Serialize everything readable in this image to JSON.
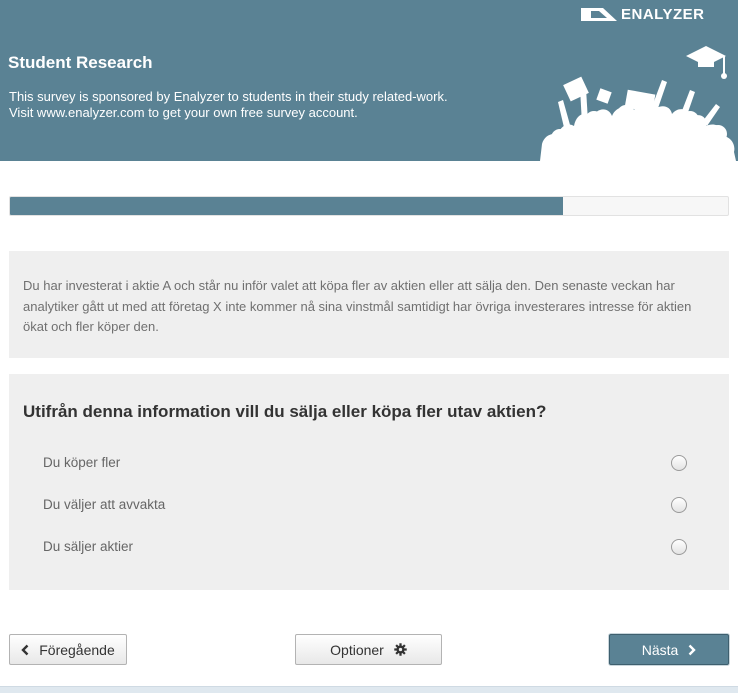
{
  "header": {
    "brand": "ENALYZER",
    "title": "Student Research",
    "description_lines": [
      "This survey is sponsored by Enalyzer to students in their study related-work.",
      "Visit www.enalyzer.com to get your own free survey account."
    ]
  },
  "progress": {
    "fraction": 0.77
  },
  "info": {
    "text": "Du har investerat i aktie A och står nu inför valet att köpa fler av aktien eller att sälja den. Den senaste veckan har analytiker gått ut med att företag X inte kommer nå sina vinstmål samtidigt har övriga investerares intresse för aktien ökat och fler köper den."
  },
  "question": {
    "title": "Utifrån denna information vill du sälja eller köpa fler utav aktien?",
    "options": [
      {
        "label": "Du köper fler",
        "selected": false
      },
      {
        "label": "Du väljer att avvakta",
        "selected": false
      },
      {
        "label": "Du säljer aktier",
        "selected": false
      }
    ]
  },
  "buttons": {
    "previous": "Föregående",
    "options": "Optioner",
    "next": "Nästa"
  },
  "colors": {
    "header_bg": "#5a8294",
    "panel_bg": "#efefef",
    "next_button_bg": "#5a8294"
  },
  "icons": {
    "logo": "enalyzer-logo-icon",
    "header_illustration": "graduates-celebrating-illustration",
    "previous": "chevron-left-icon",
    "options": "gear-icon",
    "next": "chevron-right-icon"
  }
}
